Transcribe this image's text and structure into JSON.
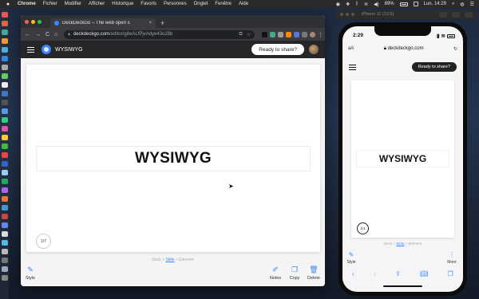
{
  "menubar": {
    "apple": "",
    "items": [
      "Chrome",
      "Fichier",
      "Modifier",
      "Afficher",
      "Historique",
      "Favoris",
      "Personnes",
      "Onglet",
      "Fenêtre",
      "Aide"
    ],
    "battery": "89%",
    "clock": "Lun. 14:29"
  },
  "browser": {
    "tab_title": "DeckDeckGo – The web open s",
    "tab_close": "×",
    "new_tab": "+",
    "url_host": "deckdeckgo.com",
    "url_path": "/editor/g8eALfPjvAdye43o28b",
    "back": "←",
    "forward": "→",
    "reload": "C",
    "home": "⌂"
  },
  "app": {
    "name": "WYSIWYG",
    "share_button": "Ready to share?",
    "slide_title": "WYSIWYG",
    "slide_counter": "1/7",
    "breadcrumb": {
      "deck": "Deck",
      "sep1": " > ",
      "slide": "Slide",
      "sep2": " > ",
      "element": "Element"
    },
    "tools": {
      "style": "Style",
      "notes": "Notes",
      "copy": "Copy",
      "delete": "Delete"
    }
  },
  "simulator": {
    "title": "iPhone 11 (13.5)",
    "time": "2:29",
    "aa": "aA",
    "url": "deckdeckgo.com",
    "share_button": "Ready to share?",
    "slide_title": "WYSIWYG",
    "slide_counter": "1/1",
    "breadcrumb": {
      "deck": "Deck",
      "sep1": " > ",
      "slide": "Slide",
      "sep2": " > ",
      "element": "Element"
    },
    "tools": {
      "style": "Style",
      "more": "More"
    }
  },
  "colors": {
    "accent": "#3a86ff",
    "appbar": "#262628",
    "tab_dark": "#2f3033"
  }
}
